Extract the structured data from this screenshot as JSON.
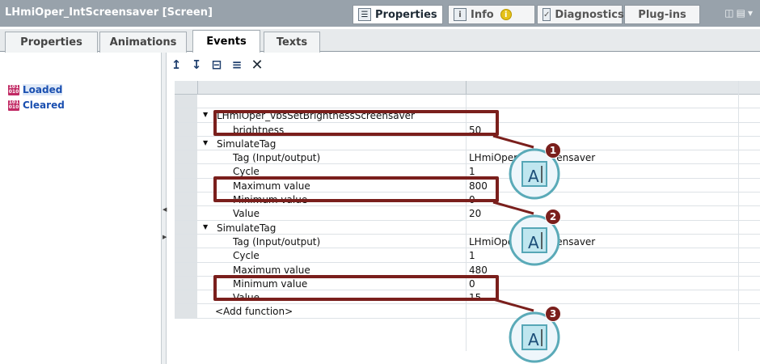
{
  "window": {
    "title": "LHmiOper_IntScreensaver [Screen]",
    "tabs": [
      {
        "label": "Properties",
        "icon": "properties-icon",
        "active": true
      },
      {
        "label": "Info",
        "icon": "info-icon",
        "active": false
      },
      {
        "label": "Diagnostics",
        "icon": "diagnostics-icon",
        "active": false
      },
      {
        "label": "Plug-ins",
        "icon": "",
        "active": false
      }
    ]
  },
  "subtabs": [
    {
      "label": "Properties",
      "active": false
    },
    {
      "label": "Animations",
      "active": false
    },
    {
      "label": "Events",
      "active": true
    },
    {
      "label": "Texts",
      "active": false
    }
  ],
  "events": [
    {
      "label": "Loaded",
      "selected": true
    },
    {
      "label": "Cleared",
      "selected": false
    }
  ],
  "toolbar": [
    "move-up-icon",
    "move-down-icon",
    "collapse-icon",
    "expand-icon",
    "delete-icon"
  ],
  "rows": [
    {
      "name": "",
      "value": "",
      "level": 0
    },
    {
      "name": "LHmiOper_vbsSetBrightnessScreensaver",
      "value": "",
      "level": 1
    },
    {
      "name": "brightness",
      "value": "50",
      "level": 2
    },
    {
      "name": "SimulateTag",
      "value": "",
      "level": 1
    },
    {
      "name": "Tag (Input/output)",
      "value": "LHmiOper_IntScreensaver",
      "level": 2
    },
    {
      "name": "Cycle",
      "value": "1",
      "level": 2
    },
    {
      "name": "Maximum value",
      "value": "800",
      "level": 2
    },
    {
      "name": "Minimum value",
      "value": "0",
      "level": 2
    },
    {
      "name": "Value",
      "value": "20",
      "level": 2
    },
    {
      "name": "SimulateTag",
      "value": "",
      "level": 1
    },
    {
      "name": "Tag (Input/output)",
      "value": "LHmiOper_IntScreensaver",
      "level": 2
    },
    {
      "name": "Cycle",
      "value": "1",
      "level": 2
    },
    {
      "name": "Maximum value",
      "value": "480",
      "level": 2
    },
    {
      "name": "Minimum value",
      "value": "0",
      "level": 2
    },
    {
      "name": "Value",
      "value": "15",
      "level": 2
    },
    {
      "name": "<Add function>",
      "value": "",
      "level": 1
    }
  ],
  "callouts": [
    {
      "number": "1",
      "icon": "text-cursor-icon",
      "glyph": "A"
    },
    {
      "number": "2",
      "icon": "text-cursor-icon",
      "glyph": "A"
    },
    {
      "number": "3",
      "icon": "text-cursor-icon",
      "glyph": "A"
    }
  ],
  "colors": {
    "highlight": "#7a1f1c",
    "titlebar": "#98a2ab",
    "link": "#1a4fb0"
  }
}
